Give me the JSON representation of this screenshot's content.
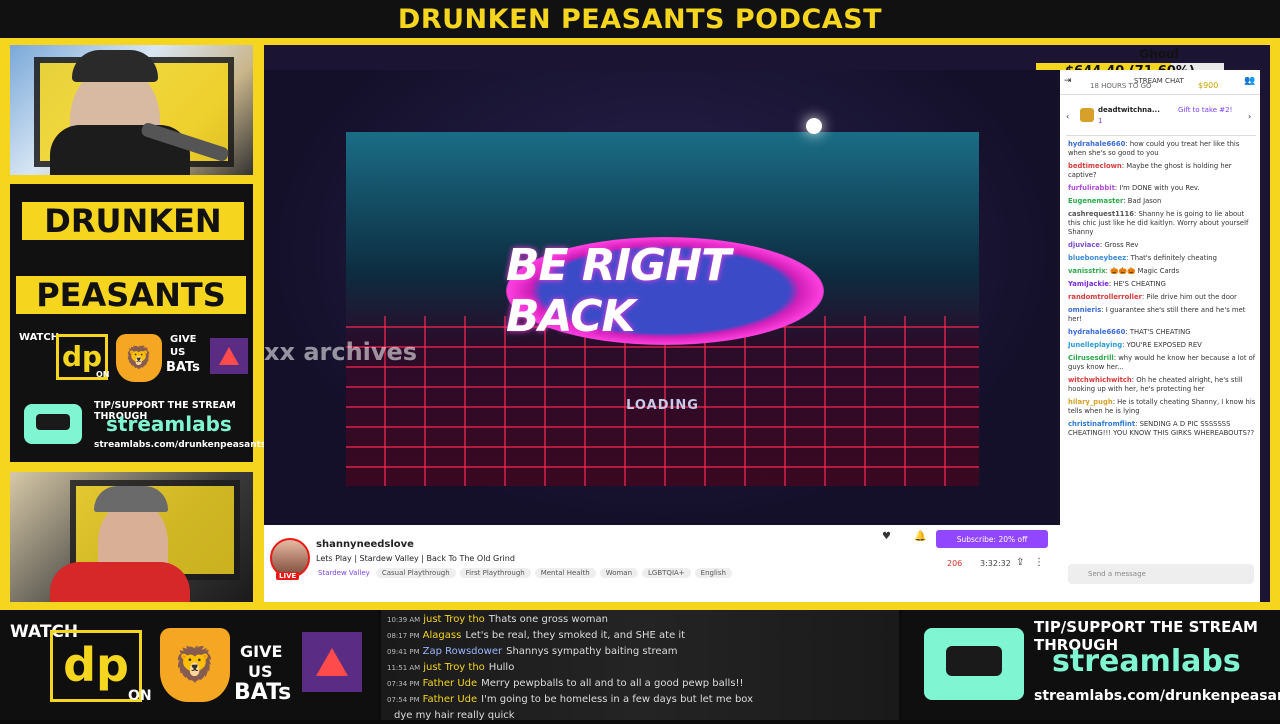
{
  "title": "DRUNKEN PEASANTS PODCAST",
  "left_panel": {
    "word1": "DRUNKEN",
    "word2": "PEASANTS",
    "watch": "WATCH",
    "on": "ON",
    "give": "GIVE",
    "us": "US",
    "bats": "BATs",
    "tip": "TIP/SUPPORT THE STREAM THROUGH",
    "streamlabs": "streamlabs",
    "url": "streamlabs.com/drunkenpeasants"
  },
  "stream": {
    "brb": "BE RIGHT BACK",
    "loading": "LOADING",
    "watermark": "xx archives",
    "streamer": "shannyneedslove",
    "live": "LIVE",
    "stream_title": "Lets Play | Stardew Valley | Back To The Old Grind",
    "game": "Stardew Valley",
    "tags": [
      "Casual Playthrough",
      "First Playthrough",
      "Mental Health",
      "Woman",
      "LGBTQIA+",
      "English"
    ],
    "subscribe": "Subscribe: 20% off",
    "viewers": "206",
    "uptime": "3:32:32"
  },
  "goal": {
    "name": "Ghoul",
    "value": "$644.40 (71.60%)",
    "progress": 0.716,
    "min": "$0",
    "max": "$900",
    "time": "18 HOURS TO GO"
  },
  "chat": {
    "header": "STREAM CHAT",
    "pinned_user": "deadtwitchna...",
    "pinned_count": "1",
    "gift": "Gift to take #2!",
    "input_placeholder": "Send a message",
    "messages": [
      {
        "user": "hydrahale6660",
        "color": "#3a6bd6",
        "text": "how could you treat her like this when she's so good to you"
      },
      {
        "user": "bedtimeclown",
        "color": "#d63a3a",
        "text": "Maybe the ghost is holding her captive?"
      },
      {
        "user": "furfulirabbit",
        "color": "#b04ad6",
        "text": "I'm DONE with you Rev."
      },
      {
        "user": "Eugenemaster",
        "color": "#2aa84a",
        "text": "Bad Jason"
      },
      {
        "user": "cashrequest1116",
        "color": "#555",
        "text": "Shanny he is going to lie about this chic just like he did kaitlyn. Worry about yourself Shanny"
      },
      {
        "user": "djuviace",
        "color": "#7a4ad6",
        "text": "Gross Rev"
      },
      {
        "user": "blueboneybeez",
        "color": "#3a8ad6",
        "text": "That's definitely cheating"
      },
      {
        "user": "vanisstrix",
        "color": "#2aa84a",
        "text": "🎃🎃🎃 Magic Cards"
      },
      {
        "user": "YamiJackie",
        "color": "#7a2ad6",
        "text": "HE'S CHEATING"
      },
      {
        "user": "randomtrollerroller",
        "color": "#d63a3a",
        "text": "Pile drive him out the door"
      },
      {
        "user": "omnieris",
        "color": "#3a6bd6",
        "text": "I guarantee she's still there and he's met her!"
      },
      {
        "user": "hydrahale6660",
        "color": "#3a6bd6",
        "text": "THAT'S CHEATING"
      },
      {
        "user": "Junelleplaying",
        "color": "#2a9ad6",
        "text": "YOU'RE EXPOSED REV"
      },
      {
        "user": "Cilrusesdrill",
        "color": "#2aa84a",
        "text": "why would he know her because a lot of guys know her..."
      },
      {
        "user": "witchwhichwitch",
        "color": "#d63a3a",
        "text": "Oh he cheated alright, he's still hooking up with her, he's protecting her"
      },
      {
        "user": "hilary_pugh",
        "color": "#d6a02a",
        "text": "He is totally cheating Shanny, I know his tells when he is lying"
      },
      {
        "user": "christinafromflint",
        "color": "#2a7ad6",
        "text": "SENDING A D PIC SSSSSSS CHEATING!!! YOU KNOW THIS GIRKS WHEREABOUTS??"
      }
    ]
  },
  "bottom_chat": [
    {
      "time": "10:39 AM",
      "user": "just Troy tho",
      "style": "u",
      "text": "Thats one gross woman"
    },
    {
      "time": "08:17 PM",
      "user": "Alagass",
      "style": "u",
      "text": "Let's be real, they smoked it, and SHE ate it"
    },
    {
      "time": "09:41 PM",
      "user": "Zap Rowsdower",
      "style": "u2",
      "text": "Shannys sympathy baiting stream"
    },
    {
      "time": "11:51 AM",
      "user": "just Troy tho",
      "style": "u",
      "text": "Hullo"
    },
    {
      "time": "07:34 PM",
      "user": "Father Ude",
      "style": "u",
      "text": "Merry pewpballs to all and to all a good pewp balls!!"
    },
    {
      "time": "07:54 PM",
      "user": "Father Ude",
      "style": "u",
      "text": "I'm going to be homeless in a few days but let me box"
    },
    {
      "time": "",
      "user": "",
      "style": "u",
      "text": "dye my hair really quick"
    }
  ]
}
